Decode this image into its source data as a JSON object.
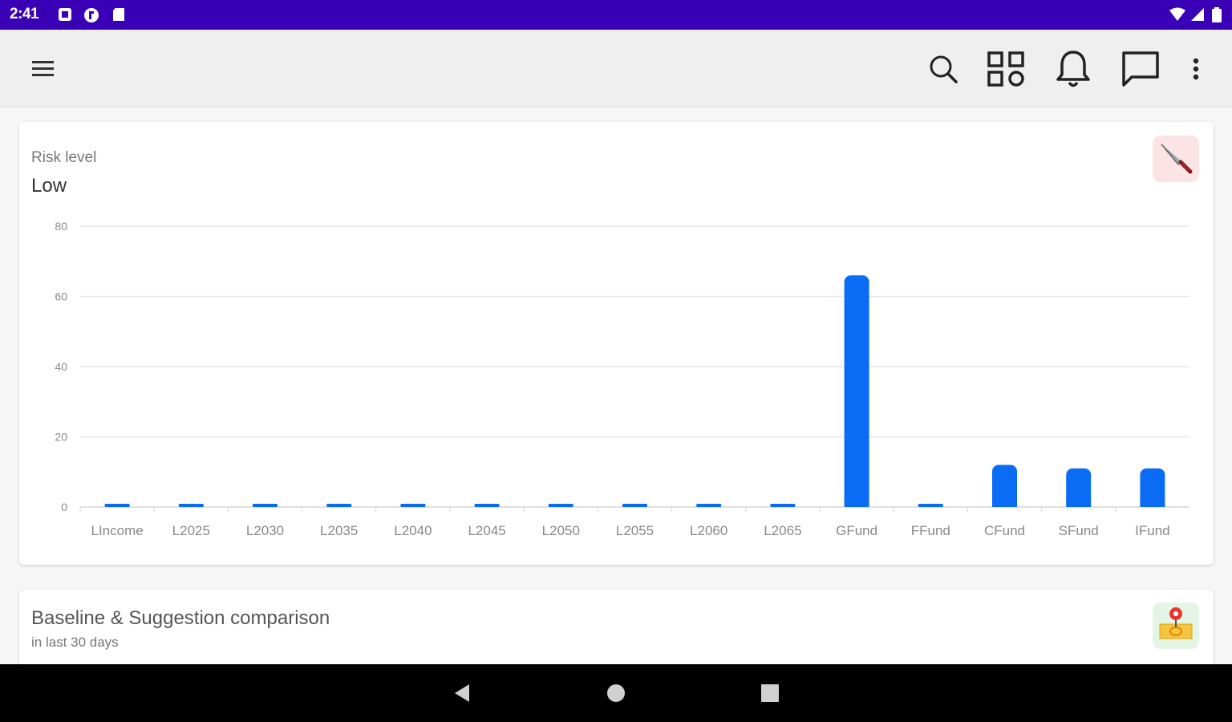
{
  "status_bar": {
    "time": "2:41",
    "left_icons": [
      "notification-square-icon",
      "app-circle-icon",
      "sd-card-icon"
    ],
    "right_icons": [
      "wifi-icon",
      "signal-icon",
      "battery-icon"
    ]
  },
  "app_bar": {
    "icons": [
      "menu-icon",
      "search-icon",
      "apps-grid-icon",
      "bell-icon",
      "chat-icon",
      "more-vert-icon"
    ]
  },
  "risk_card": {
    "label": "Risk level",
    "value": "Low",
    "badge_icon": "knife-icon",
    "badge_color": "#fce4e6"
  },
  "comparison_card": {
    "title": "Baseline & Suggestion comparison",
    "subtitle": "in last 30 days",
    "badge_icon": "money-pin-icon",
    "badge_color": "#e4f5e6"
  },
  "chart_data": {
    "type": "bar",
    "categories": [
      "LIncome",
      "L2025",
      "L2030",
      "L2035",
      "L2040",
      "L2045",
      "L2050",
      "L2055",
      "L2060",
      "L2065",
      "GFund",
      "FFund",
      "CFund",
      "SFund",
      "IFund"
    ],
    "values": [
      0,
      0,
      0,
      0,
      0,
      0,
      0,
      0,
      0,
      0,
      66,
      0,
      12,
      11,
      11
    ],
    "ylim": [
      0,
      80
    ],
    "yticks": [
      0,
      20,
      40,
      60,
      80
    ],
    "grid": true,
    "bar_color": "#0a6cf5"
  },
  "nav_bar": {
    "icons": [
      "back-icon",
      "home-icon",
      "recents-icon"
    ]
  }
}
